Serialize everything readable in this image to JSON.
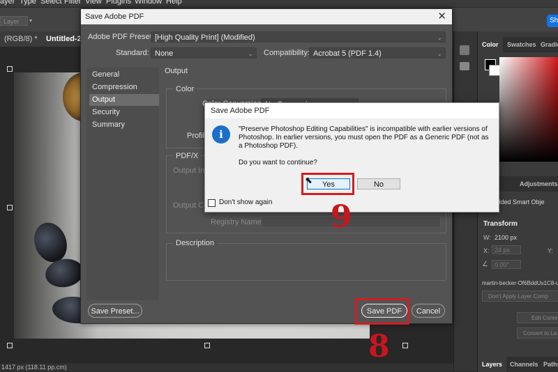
{
  "menubar": [
    "ayer",
    "Type",
    "Select",
    "Filter",
    "View",
    "Plugins",
    "Window",
    "Help"
  ],
  "optionsbar": {
    "layer_select": "Layer",
    "share_label": "Sh"
  },
  "tabs": {
    "doc1": "(RGB/8) *",
    "doc2": "Untitled-2 @"
  },
  "status": "1417 px (118.11 pp.cm)",
  "right_panels": {
    "color_tabs": [
      "Color",
      "Swatches",
      "Gradie"
    ],
    "props_tabs": [
      "rties",
      "Adjustments"
    ],
    "embedded": "Embedded Smart Obje",
    "transform": "Transform",
    "w_label": "W:",
    "w_value": "2100 px",
    "x_label": "X:",
    "x_value": "24 px",
    "y_label": "Y:",
    "angle_value": "0.00°",
    "filename": "martin-becker-Of6BddUs1C8-u",
    "layer_comp": "Don't Apply Layer Comp",
    "edit_contents": "Edit Conte",
    "convert": "Convert to La",
    "bottom_tabs": [
      "Layers",
      "Channels",
      "Paths"
    ]
  },
  "dialog": {
    "title": "Save Adobe PDF",
    "preset_label": "Adobe PDF Preset:",
    "preset_value": "[High Quality Print] (Modified)",
    "standard_label": "Standard:",
    "standard_value": "None",
    "compat_label": "Compatibility:",
    "compat_value": "Acrobat 5 (PDF 1.4)",
    "nav": [
      "General",
      "Compression",
      "Output",
      "Security",
      "Summary"
    ],
    "section_title": "Output",
    "color_group": "Color",
    "color_conv": "Color Conversion:",
    "color_conv_value": "No Conversion",
    "profile": "Profile",
    "pdfx_group": "PDF/X",
    "output_intent": "Output Inte",
    "c_label": "C",
    "output_cond": "Output Co",
    "registry": "Registry Name:",
    "description": "Description",
    "save_preset": "Save Preset...",
    "save_pdf": "Save PDF",
    "cancel": "Cancel"
  },
  "alert": {
    "title": "Save Adobe PDF",
    "message": "\"Preserve Photoshop Editing Capabilities\" is incompatible with earlier versions of Photoshop. In earlier versions, you must open the PDF as a Generic PDF (not as a Photoshop PDF).",
    "question": "Do you want to continue?",
    "yes": "Yes",
    "no": "No",
    "dont_show": "Don't show again",
    "icon": "info-icon"
  },
  "annotations": {
    "step_save": "8",
    "step_yes": "9",
    "highlight_color": "#d31d20"
  }
}
